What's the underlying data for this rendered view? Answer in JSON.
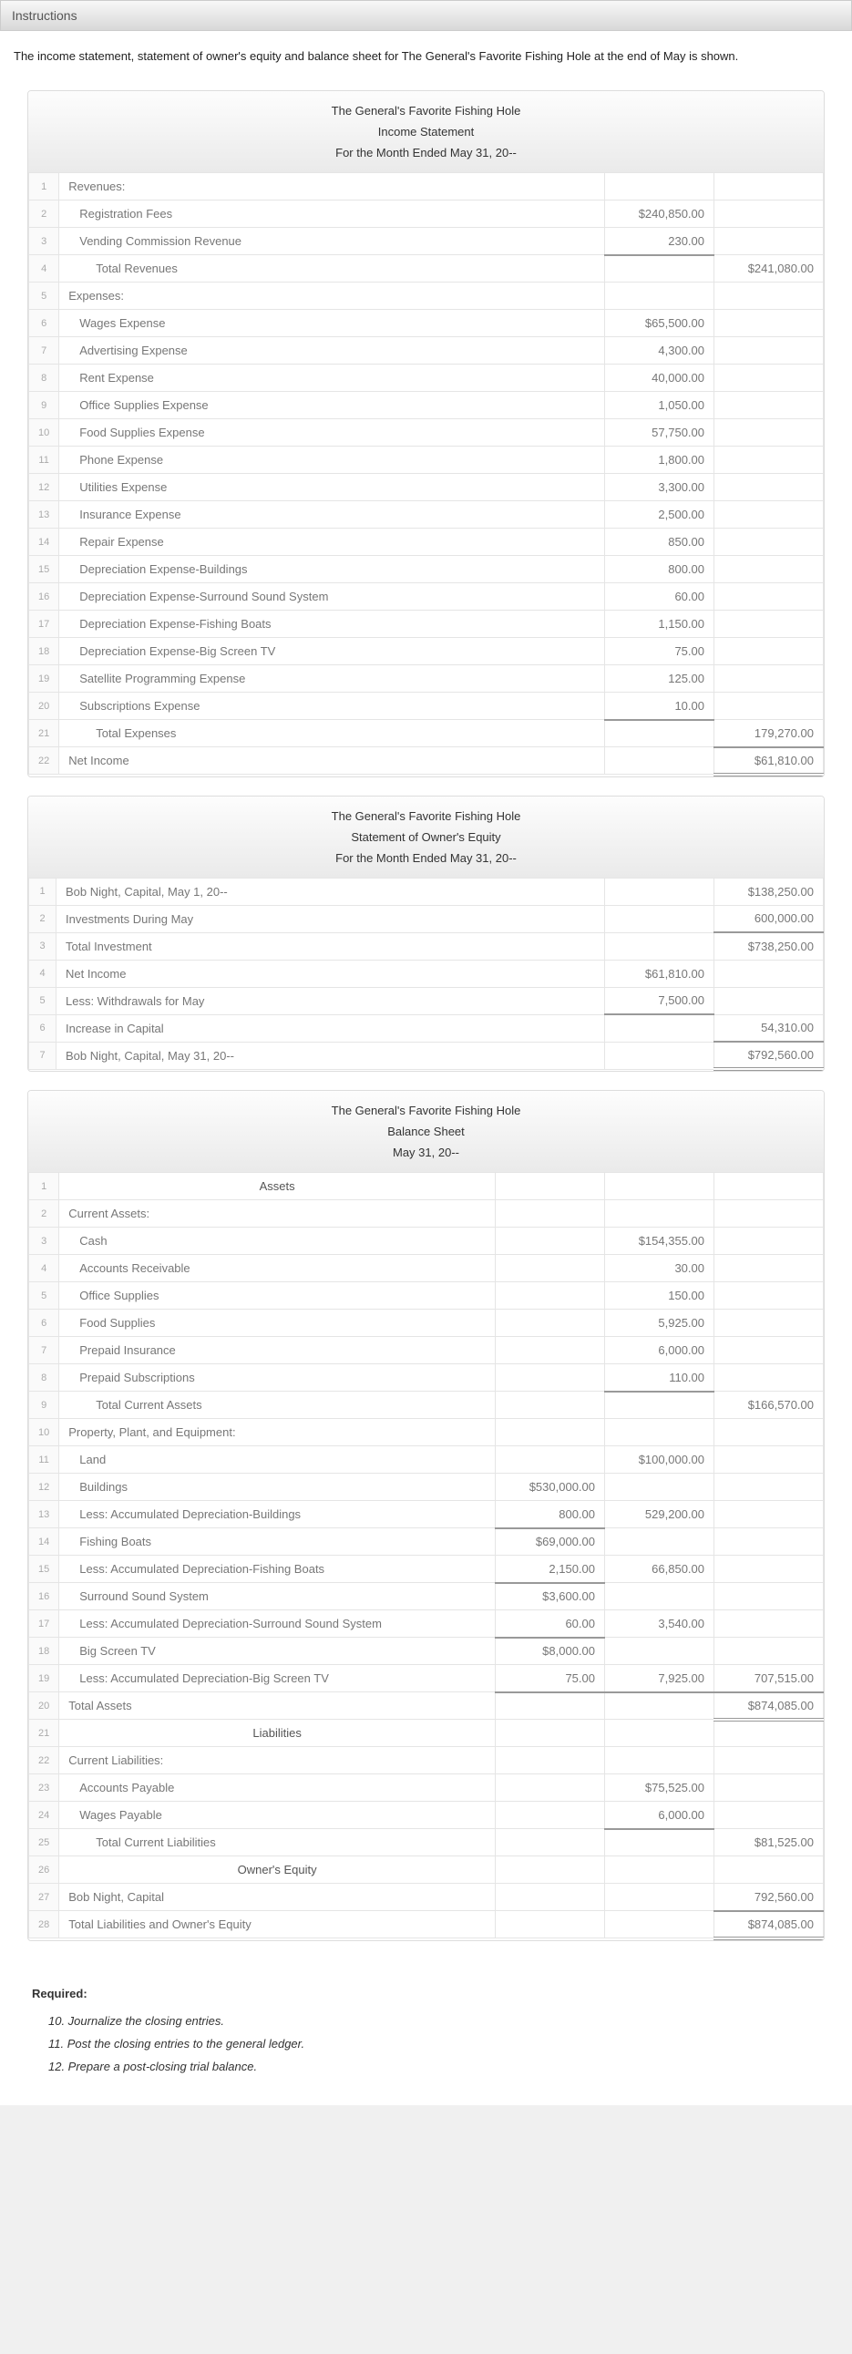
{
  "header": {
    "instructions": "Instructions"
  },
  "intro": "The income statement, statement of owner's equity and balance sheet for The General's Favorite Fishing Hole at the end of May is shown.",
  "income": {
    "company": "The General's Favorite Fishing Hole",
    "title": "Income Statement",
    "period": "For the Month Ended May 31, 20--",
    "rows": {
      "r1": "Revenues:",
      "r2l": "Registration Fees",
      "r2a": "$240,850.00",
      "r3l": "Vending Commission Revenue",
      "r3a": "230.00",
      "r4l": "Total Revenues",
      "r4b": "$241,080.00",
      "r5": "Expenses:",
      "r6l": "Wages Expense",
      "r6a": "$65,500.00",
      "r7l": "Advertising Expense",
      "r7a": "4,300.00",
      "r8l": "Rent Expense",
      "r8a": "40,000.00",
      "r9l": "Office Supplies Expense",
      "r9a": "1,050.00",
      "r10l": "Food Supplies Expense",
      "r10a": "57,750.00",
      "r11l": "Phone Expense",
      "r11a": "1,800.00",
      "r12l": "Utilities Expense",
      "r12a": "3,300.00",
      "r13l": "Insurance Expense",
      "r13a": "2,500.00",
      "r14l": "Repair Expense",
      "r14a": "850.00",
      "r15l": "Depreciation Expense-Buildings",
      "r15a": "800.00",
      "r16l": "Depreciation Expense-Surround Sound System",
      "r16a": "60.00",
      "r17l": "Depreciation Expense-Fishing Boats",
      "r17a": "1,150.00",
      "r18l": "Depreciation Expense-Big Screen TV",
      "r18a": "75.00",
      "r19l": "Satellite Programming Expense",
      "r19a": "125.00",
      "r20l": "Subscriptions Expense",
      "r20a": "10.00",
      "r21l": "Total Expenses",
      "r21b": "179,270.00",
      "r22l": "Net Income",
      "r22b": "$61,810.00"
    }
  },
  "equity": {
    "company": "The General's Favorite Fishing Hole",
    "title": "Statement of Owner's Equity",
    "period": "For the Month Ended May 31, 20--",
    "rows": {
      "r1l": "Bob Night, Capital, May 1, 20--",
      "r1b": "$138,250.00",
      "r2l": "Investments During May",
      "r2b": "600,000.00",
      "r3l": "Total Investment",
      "r3b": "$738,250.00",
      "r4l": "Net Income",
      "r4a": "$61,810.00",
      "r5l": "Less: Withdrawals for May",
      "r5a": "7,500.00",
      "r6l": "Increase in Capital",
      "r6b": "54,310.00",
      "r7l": "Bob Night, Capital, May 31, 20--",
      "r7b": "$792,560.00"
    }
  },
  "balance": {
    "company": "The General's Favorite Fishing Hole",
    "title": "Balance Sheet",
    "period": "May 31, 20--",
    "rows": {
      "s1": "Assets",
      "r2": "Current Assets:",
      "r3l": "Cash",
      "r3b": "$154,355.00",
      "r4l": "Accounts Receivable",
      "r4b": "30.00",
      "r5l": "Office Supplies",
      "r5b": "150.00",
      "r6l": "Food Supplies",
      "r6b": "5,925.00",
      "r7l": "Prepaid Insurance",
      "r7b": "6,000.00",
      "r8l": "Prepaid Subscriptions",
      "r8b": "110.00",
      "r9l": "Total Current Assets",
      "r9c": "$166,570.00",
      "r10": "Property, Plant, and Equipment:",
      "r11l": "Land",
      "r11b": "$100,000.00",
      "r12l": "Buildings",
      "r12a": "$530,000.00",
      "r13l": "Less: Accumulated Depreciation-Buildings",
      "r13a": "800.00",
      "r13b": "529,200.00",
      "r14l": "Fishing Boats",
      "r14a": "$69,000.00",
      "r15l": "Less: Accumulated Depreciation-Fishing Boats",
      "r15a": "2,150.00",
      "r15b": "66,850.00",
      "r16l": "Surround Sound System",
      "r16a": "$3,600.00",
      "r17l": "Less: Accumulated Depreciation-Surround Sound System",
      "r17a": "60.00",
      "r17b": "3,540.00",
      "r18l": "Big Screen TV",
      "r18a": "$8,000.00",
      "r19l": "Less: Accumulated Depreciation-Big Screen TV",
      "r19a": "75.00",
      "r19b": "7,925.00",
      "r19c": "707,515.00",
      "r20l": "Total Assets",
      "r20c": "$874,085.00",
      "s21": "Liabilities",
      "r22": "Current Liabilities:",
      "r23l": "Accounts Payable",
      "r23b": "$75,525.00",
      "r24l": "Wages Payable",
      "r24b": "6,000.00",
      "r25l": "Total Current Liabilities",
      "r25c": "$81,525.00",
      "s26": "Owner's Equity",
      "r27l": "Bob Night, Capital",
      "r27c": "792,560.00",
      "r28l": "Total Liabilities and Owner's Equity",
      "r28c": "$874,085.00"
    }
  },
  "required": {
    "title": "Required:",
    "r10": "10. Journalize the closing entries.",
    "r11": "11. Post the closing entries to the general ledger.",
    "r12": "12. Prepare a post-closing trial balance."
  }
}
